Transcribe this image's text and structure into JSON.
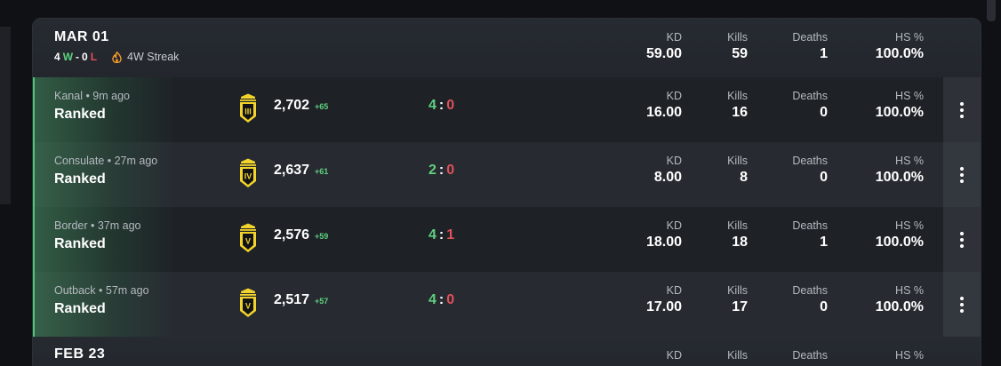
{
  "colors": {
    "win": "#5fd07e",
    "loss": "#e0505a",
    "rank_gold": "#f2d32b",
    "accent_green": "#4cc77a"
  },
  "days": [
    {
      "title": "MAR 01",
      "record": {
        "wins": "4",
        "w_letter": "W",
        "dash": "-",
        "losses": "0",
        "l_letter": "L"
      },
      "streak": {
        "icon": "flame-icon",
        "text": "4W Streak"
      },
      "stats": {
        "kd_label": "KD",
        "kd": "59.00",
        "kills_label": "Kills",
        "kills": "59",
        "deaths_label": "Deaths",
        "deaths": "1",
        "hs_label": "HS %",
        "hs": "100.0%"
      },
      "matches": [
        {
          "map": "Kanal",
          "time": "9m ago",
          "meta": "Kanal • 9m ago",
          "mode": "Ranked",
          "rank_icon": "rank-III-icon",
          "rank_numeral": "III",
          "rp": "2,702",
          "rp_delta": "+65",
          "score_w": "4",
          "score_sep": ":",
          "score_l": "0",
          "kd_label": "KD",
          "kd": "16.00",
          "kills_label": "Kills",
          "kills": "16",
          "deaths_label": "Deaths",
          "deaths": "0",
          "hs_label": "HS %",
          "hs": "100.0%"
        },
        {
          "map": "Consulate",
          "time": "27m ago",
          "meta": "Consulate • 27m ago",
          "mode": "Ranked",
          "rank_icon": "rank-IV-icon",
          "rank_numeral": "IV",
          "rp": "2,637",
          "rp_delta": "+61",
          "score_w": "2",
          "score_sep": ":",
          "score_l": "0",
          "kd_label": "KD",
          "kd": "8.00",
          "kills_label": "Kills",
          "kills": "8",
          "deaths_label": "Deaths",
          "deaths": "0",
          "hs_label": "HS %",
          "hs": "100.0%"
        },
        {
          "map": "Border",
          "time": "37m ago",
          "meta": "Border • 37m ago",
          "mode": "Ranked",
          "rank_icon": "rank-V-icon",
          "rank_numeral": "V",
          "rp": "2,576",
          "rp_delta": "+59",
          "score_w": "4",
          "score_sep": ":",
          "score_l": "1",
          "kd_label": "KD",
          "kd": "18.00",
          "kills_label": "Kills",
          "kills": "18",
          "deaths_label": "Deaths",
          "deaths": "1",
          "hs_label": "HS %",
          "hs": "100.0%"
        },
        {
          "map": "Outback",
          "time": "57m ago",
          "meta": "Outback • 57m ago",
          "mode": "Ranked",
          "rank_icon": "rank-V-icon",
          "rank_numeral": "V",
          "rp": "2,517",
          "rp_delta": "+57",
          "score_w": "4",
          "score_sep": ":",
          "score_l": "0",
          "kd_label": "KD",
          "kd": "17.00",
          "kills_label": "Kills",
          "kills": "17",
          "deaths_label": "Deaths",
          "deaths": "0",
          "hs_label": "HS %",
          "hs": "100.0%"
        }
      ]
    },
    {
      "title": "FEB 23",
      "stats": {
        "kd_label": "KD",
        "kills_label": "Kills",
        "deaths_label": "Deaths",
        "hs_label": "HS %"
      }
    }
  ]
}
